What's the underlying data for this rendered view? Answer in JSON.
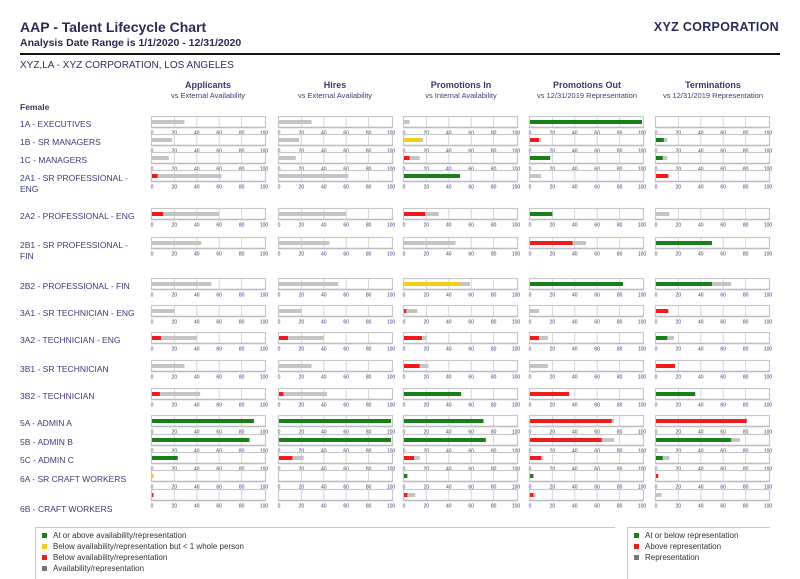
{
  "header": {
    "title": "AAP - Talent Lifecycle Chart",
    "subtitle": "Analysis Date Range is 1/1/2020 - 12/31/2020",
    "company": "XYZ CORPORATION",
    "location": "XYZ,LA - XYZ CORPORATION, LOS ANGELES"
  },
  "colors": {
    "green": "#1a7f1a",
    "yellow": "#f5cc1c",
    "red": "#ee1c1c",
    "gray": "#c4c4c4",
    "frame": "#c8c8c8",
    "tick_text": "#3a3a7a"
  },
  "legend": {
    "left": [
      {
        "color": "green",
        "label": "At or above availability/representation"
      },
      {
        "color": "yellow",
        "label": "Below availability/representation but < 1 whole person"
      },
      {
        "color": "red",
        "label": "Below availability/representation"
      },
      {
        "color": "darkgray",
        "label": "Availability/representation"
      }
    ],
    "right": [
      {
        "color": "green",
        "label": "At or below representation"
      },
      {
        "color": "red",
        "label": "Above representation"
      },
      {
        "color": "darkgray",
        "label": "Representation"
      }
    ]
  },
  "chart_data": {
    "type": "bar",
    "title": "AAP - Talent Lifecycle Chart",
    "group": "Female",
    "xlim": [
      0,
      100
    ],
    "xticks": [
      "0",
      "20",
      "40",
      "60",
      "80",
      "100"
    ],
    "columns": [
      {
        "name": "Applicants",
        "sub": "vs External Availability"
      },
      {
        "name": "Hires",
        "sub": "vs External Availability"
      },
      {
        "name": "Promotions In",
        "sub": "vs Internal Availability"
      },
      {
        "name": "Promotions Out",
        "sub": "vs 12/31/2019 Representation"
      },
      {
        "name": "Terminations",
        "sub": "vs 12/31/2019 Representation"
      }
    ],
    "rows": [
      {
        "label": "1A - EXECUTIVES",
        "cells": [
          {
            "value": 0,
            "benchmark": 29,
            "status": "none"
          },
          {
            "value": 0,
            "benchmark": 29,
            "status": "none"
          },
          {
            "value": 0,
            "benchmark": 5,
            "status": "none"
          },
          {
            "value": 100,
            "benchmark": 100,
            "status": "green"
          },
          {
            "value": 0,
            "benchmark": 0,
            "status": "none"
          }
        ]
      },
      {
        "label": "1B - SR MANAGERS",
        "cells": [
          {
            "value": 0,
            "benchmark": 18,
            "status": "none"
          },
          {
            "value": 0,
            "benchmark": 18,
            "status": "none"
          },
          {
            "value": 15,
            "benchmark": 17,
            "status": "yellow"
          },
          {
            "value": 8,
            "benchmark": 10,
            "status": "red"
          },
          {
            "value": 7,
            "benchmark": 10,
            "status": "green"
          }
        ]
      },
      {
        "label": "1C - MANAGERS",
        "cells": [
          {
            "value": 0,
            "benchmark": 15,
            "status": "none"
          },
          {
            "value": 0,
            "benchmark": 15,
            "status": "none"
          },
          {
            "value": 5,
            "benchmark": 14,
            "status": "red"
          },
          {
            "value": 18,
            "benchmark": 18,
            "status": "green"
          },
          {
            "value": 6,
            "benchmark": 10,
            "status": "green"
          }
        ]
      },
      {
        "label": "2A1 - SR PROFESSIONAL - ENG",
        "cells": [
          {
            "value": 5,
            "benchmark": 62,
            "status": "red"
          },
          {
            "value": 0,
            "benchmark": 62,
            "status": "none"
          },
          {
            "value": 50,
            "benchmark": 50,
            "status": "green"
          },
          {
            "value": 0,
            "benchmark": 10,
            "status": "none"
          },
          {
            "value": 11,
            "benchmark": 11,
            "status": "red"
          }
        ]
      },
      {
        "label": "2A2 - PROFESSIONAL - ENG",
        "cells": [
          {
            "value": 10,
            "benchmark": 60,
            "status": "red"
          },
          {
            "value": 0,
            "benchmark": 60,
            "status": "none"
          },
          {
            "value": 19,
            "benchmark": 31,
            "status": "red"
          },
          {
            "value": 20,
            "benchmark": 20,
            "status": "green"
          },
          {
            "value": 0,
            "benchmark": 12,
            "status": "none"
          }
        ]
      },
      {
        "label": "2B1 - SR PROFESSIONAL - FIN",
        "cells": [
          {
            "value": 0,
            "benchmark": 44,
            "status": "none"
          },
          {
            "value": 0,
            "benchmark": 45,
            "status": "none"
          },
          {
            "value": 0,
            "benchmark": 46,
            "status": "none"
          },
          {
            "value": 38,
            "benchmark": 50,
            "status": "red"
          },
          {
            "value": 50,
            "benchmark": 50,
            "status": "green"
          }
        ]
      },
      {
        "label": "2B2 - PROFESSIONAL - FIN",
        "cells": [
          {
            "value": 0,
            "benchmark": 53,
            "status": "none"
          },
          {
            "value": 0,
            "benchmark": 53,
            "status": "none"
          },
          {
            "value": 50,
            "benchmark": 59,
            "status": "yellow"
          },
          {
            "value": 83,
            "benchmark": 83,
            "status": "green"
          },
          {
            "value": 50,
            "benchmark": 67,
            "status": "green"
          }
        ]
      },
      {
        "label": "3A1 - SR TECHNICIAN - ENG",
        "cells": [
          {
            "value": 0,
            "benchmark": 20,
            "status": "none"
          },
          {
            "value": 0,
            "benchmark": 20,
            "status": "none"
          },
          {
            "value": 2,
            "benchmark": 12,
            "status": "red"
          },
          {
            "value": 0,
            "benchmark": 8,
            "status": "none"
          },
          {
            "value": 11,
            "benchmark": 11,
            "status": "red"
          }
        ]
      },
      {
        "label": "3A2 - TECHNICIAN - ENG",
        "cells": [
          {
            "value": 8,
            "benchmark": 40,
            "status": "red"
          },
          {
            "value": 8,
            "benchmark": 40,
            "status": "red"
          },
          {
            "value": 16,
            "benchmark": 20,
            "status": "red"
          },
          {
            "value": 8,
            "benchmark": 16,
            "status": "red"
          },
          {
            "value": 10,
            "benchmark": 16,
            "status": "green"
          }
        ]
      },
      {
        "label": "3B1 - SR TECHNICIAN",
        "cells": [
          {
            "value": 0,
            "benchmark": 29,
            "status": "none"
          },
          {
            "value": 0,
            "benchmark": 29,
            "status": "none"
          },
          {
            "value": 14,
            "benchmark": 22,
            "status": "red"
          },
          {
            "value": 0,
            "benchmark": 16,
            "status": "none"
          },
          {
            "value": 17,
            "benchmark": 17,
            "status": "red"
          }
        ]
      },
      {
        "label": "3B2 - TECHNICIAN",
        "cells": [
          {
            "value": 7,
            "benchmark": 43,
            "status": "red"
          },
          {
            "value": 4,
            "benchmark": 43,
            "status": "red"
          },
          {
            "value": 51,
            "benchmark": 51,
            "status": "green"
          },
          {
            "value": 35,
            "benchmark": 35,
            "status": "red"
          },
          {
            "value": 35,
            "benchmark": 35,
            "status": "green"
          }
        ]
      },
      {
        "label": "5A - ADMIN A",
        "cells": [
          {
            "value": 91,
            "benchmark": 91,
            "status": "green"
          },
          {
            "value": 100,
            "benchmark": 100,
            "status": "green"
          },
          {
            "value": 71,
            "benchmark": 71,
            "status": "green"
          },
          {
            "value": 73,
            "benchmark": 75,
            "status": "red"
          },
          {
            "value": 81,
            "benchmark": 81,
            "status": "red"
          }
        ]
      },
      {
        "label": "5B - ADMIN B",
        "cells": [
          {
            "value": 87,
            "benchmark": 87,
            "status": "green"
          },
          {
            "value": 100,
            "benchmark": 100,
            "status": "green"
          },
          {
            "value": 73,
            "benchmark": 73,
            "status": "green"
          },
          {
            "value": 64,
            "benchmark": 75,
            "status": "red"
          },
          {
            "value": 67,
            "benchmark": 75,
            "status": "green"
          }
        ]
      },
      {
        "label": "5C - ADMIN C",
        "cells": [
          {
            "value": 23,
            "benchmark": 23,
            "status": "green"
          },
          {
            "value": 12,
            "benchmark": 22,
            "status": "red"
          },
          {
            "value": 9,
            "benchmark": 14,
            "status": "red"
          },
          {
            "value": 10,
            "benchmark": 12,
            "status": "red"
          },
          {
            "value": 6,
            "benchmark": 12,
            "status": "green"
          }
        ]
      },
      {
        "label": "6A - SR CRAFT WORKERS",
        "cells": [
          {
            "value": 0.5,
            "benchmark": 0.5,
            "status": "yellow"
          },
          {
            "value": 0,
            "benchmark": 0,
            "status": "none"
          },
          {
            "value": 3,
            "benchmark": 3,
            "status": "green"
          },
          {
            "value": 3,
            "benchmark": 3,
            "status": "green"
          },
          {
            "value": 2,
            "benchmark": 2,
            "status": "red"
          }
        ]
      },
      {
        "label": "6B - CRAFT WORKERS",
        "cells": [
          {
            "value": 0.5,
            "benchmark": 0.5,
            "status": "red"
          },
          {
            "value": 0,
            "benchmark": 0,
            "status": "none"
          },
          {
            "value": 3,
            "benchmark": 10,
            "status": "red"
          },
          {
            "value": 3,
            "benchmark": 5,
            "status": "red"
          },
          {
            "value": 0,
            "benchmark": 5,
            "status": "none"
          }
        ]
      }
    ]
  }
}
